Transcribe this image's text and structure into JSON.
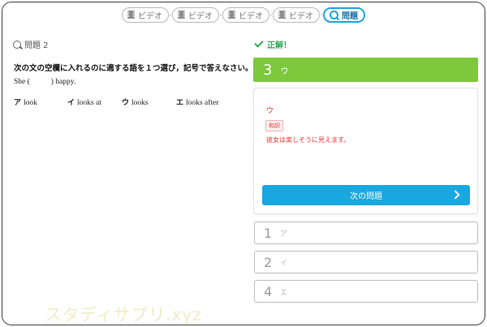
{
  "nav": {
    "steps": [
      {
        "label": "ビデオ"
      },
      {
        "label": "ビデオ"
      },
      {
        "label": "ビデオ"
      },
      {
        "label": "ビデオ"
      }
    ],
    "active_label": "問題"
  },
  "question": {
    "header": "問題 2",
    "instruction": "次の文の空欄に入れるのに適する語を１つ選び，記号で答えなさい。",
    "sentence_before": "She (",
    "sentence_after": ") happy.",
    "choices": [
      {
        "key": "ア",
        "text": "look"
      },
      {
        "key": "イ",
        "text": "looks at"
      },
      {
        "key": "ウ",
        "text": "looks"
      },
      {
        "key": "エ",
        "text": "looks after"
      }
    ]
  },
  "result": {
    "status": "正解！",
    "answer_number": "3",
    "answer_kana": "ウ",
    "explanation_answer": "ウ",
    "tag": "和訳",
    "translation": "彼女は楽しそうに見えます。",
    "next_button": "次の問題"
  },
  "other_options": [
    {
      "number": "1",
      "kana": "ア"
    },
    {
      "number": "2",
      "kana": "イ"
    },
    {
      "number": "4",
      "kana": "エ"
    }
  ],
  "watermark": "スタディサプリ.xyz",
  "colors": {
    "accent_blue": "#1aa7e0",
    "correct_green": "#7dc83c",
    "answer_red": "#e33333"
  }
}
